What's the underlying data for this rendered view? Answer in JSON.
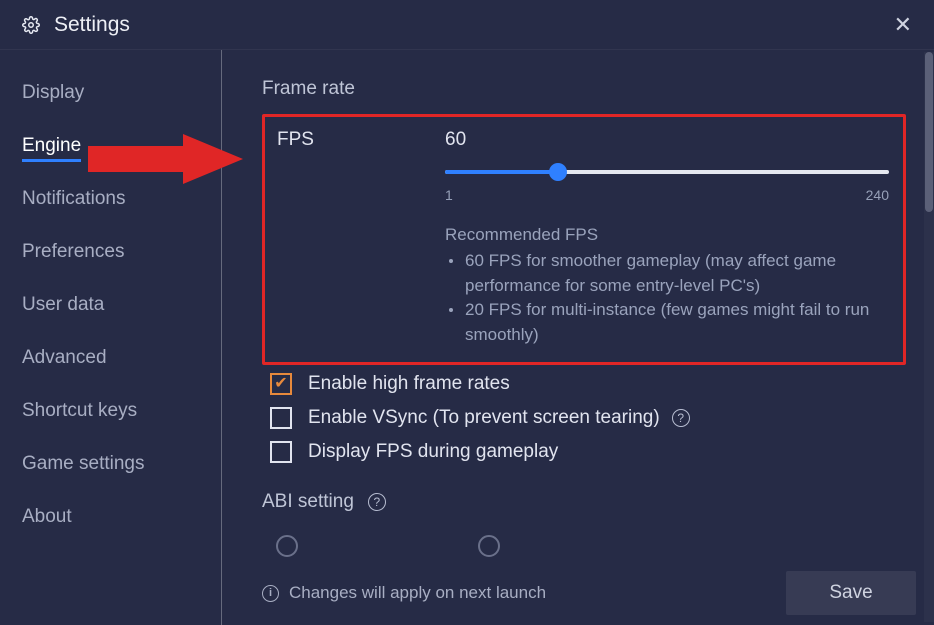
{
  "header": {
    "title": "Settings"
  },
  "sidebar": {
    "items": [
      {
        "label": "Display"
      },
      {
        "label": "Engine"
      },
      {
        "label": "Notifications"
      },
      {
        "label": "Preferences"
      },
      {
        "label": "User data"
      },
      {
        "label": "Advanced"
      },
      {
        "label": "Shortcut keys"
      },
      {
        "label": "Game settings"
      },
      {
        "label": "About"
      }
    ],
    "active_index": 1
  },
  "main": {
    "section_title": "Frame rate",
    "fps": {
      "label": "FPS",
      "value": "60",
      "min": "1",
      "max": "240"
    },
    "recommended_title": "Recommended FPS",
    "recommended": [
      "60 FPS for smoother gameplay (may affect game performance for some entry-level PC's)",
      "20 FPS for multi-instance (few games might fail to run smoothly)"
    ],
    "checks": [
      {
        "label": "Enable high frame rates",
        "checked": true
      },
      {
        "label": "Enable VSync (To prevent screen tearing)",
        "checked": false,
        "help": true
      },
      {
        "label": "Display FPS during gameplay",
        "checked": false
      }
    ],
    "abi_title": "ABI setting"
  },
  "footer": {
    "info": "Changes will apply on next launch",
    "save": "Save"
  }
}
